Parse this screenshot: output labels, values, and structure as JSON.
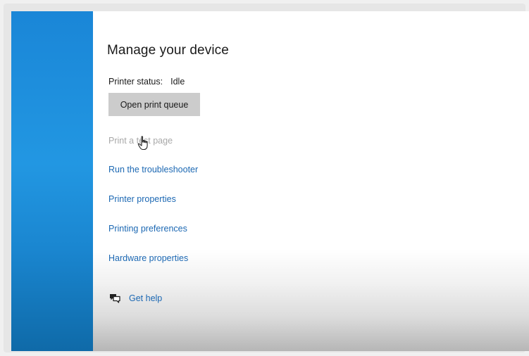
{
  "main": {
    "title": "Manage your device",
    "status_label": "Printer status:",
    "status_value": "Idle",
    "open_queue_label": "Open print queue",
    "links": [
      {
        "label": "Print a test page",
        "disabled": true
      },
      {
        "label": "Run the troubleshooter"
      },
      {
        "label": "Printer properties"
      },
      {
        "label": "Printing preferences"
      },
      {
        "label": "Hardware properties"
      }
    ],
    "help_label": "Get help"
  },
  "colors": {
    "accent_sidebar": "#1a86d7",
    "link": "#1c68b3",
    "button": "#cccccc"
  },
  "icons": {
    "help": "help-bubble-icon",
    "cursor": "hand-pointer-icon"
  }
}
